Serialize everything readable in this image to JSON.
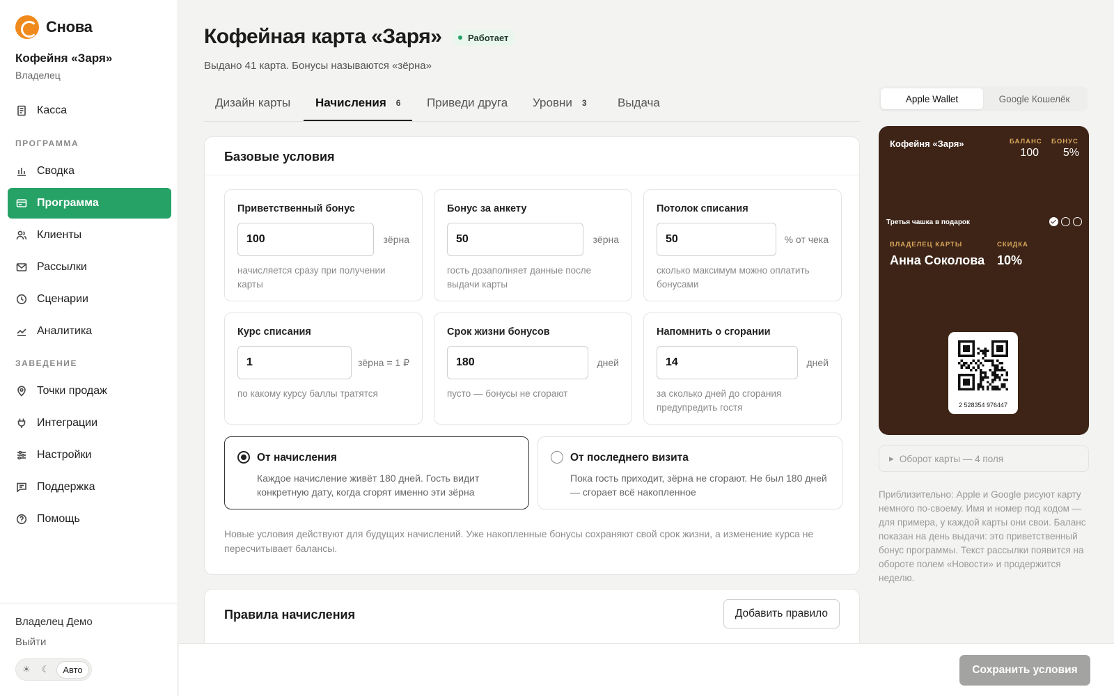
{
  "brand": {
    "name": "Снова",
    "accent": "#26a266",
    "logo_color": "#f08a1c"
  },
  "venue": {
    "name": "Кофейня «Заря»",
    "role": "Владелец"
  },
  "nav": {
    "top": [
      {
        "label": "Касса",
        "icon": "receipt-icon"
      }
    ],
    "program_section": "ПРОГРАММА",
    "program_items": [
      {
        "label": "Сводка",
        "icon": "bar-chart-icon"
      },
      {
        "label": "Программа",
        "icon": "card-icon",
        "active": true
      },
      {
        "label": "Клиенты",
        "icon": "users-icon"
      },
      {
        "label": "Рассылки",
        "icon": "mail-icon"
      },
      {
        "label": "Сценарии",
        "icon": "clock-icon"
      },
      {
        "label": "Аналитика",
        "icon": "trend-icon"
      }
    ],
    "venue_section": "ЗАВЕДЕНИЕ",
    "venue_items": [
      {
        "label": "Точки продаж",
        "icon": "pin-icon"
      },
      {
        "label": "Интеграции",
        "icon": "plug-icon"
      },
      {
        "label": "Настройки",
        "icon": "sliders-icon"
      },
      {
        "label": "Поддержка",
        "icon": "chat-icon"
      },
      {
        "label": "Помощь",
        "icon": "help-icon"
      }
    ]
  },
  "footer": {
    "user": "Владелец Демо",
    "logout": "Выйти",
    "theme_options": [
      "☀",
      "☾",
      "Авто"
    ],
    "theme_selected": "Авто"
  },
  "page": {
    "title": "Кофейная карта «Заря»",
    "status": "Работает",
    "subtitle": "Выдано 41 карта. Бонусы называются «зёрна»"
  },
  "tabs": [
    {
      "label": "Дизайн карты",
      "count": ""
    },
    {
      "label": "Начисления",
      "count": "6",
      "active": true
    },
    {
      "label": "Приведи друга",
      "count": ""
    },
    {
      "label": "Уровни",
      "count": "3"
    },
    {
      "label": "Выдача",
      "count": ""
    }
  ],
  "base": {
    "title": "Базовые условия",
    "fields": [
      {
        "label": "Приветственный бонус",
        "value": "100",
        "unit": "зёрна",
        "hint": "начисляется сразу при получении карты"
      },
      {
        "label": "Бонус за анкету",
        "value": "50",
        "unit": "зёрна",
        "hint": "гость дозаполняет данные после выдачи карты"
      },
      {
        "label": "Потолок списания",
        "value": "50",
        "unit": "% от чека",
        "hint": "сколько максимум можно оплатить бонусами"
      },
      {
        "label": "Курс списания",
        "value": "1",
        "unit": "зёрна = 1 ₽",
        "hint": "по какому курсу баллы тратятся"
      },
      {
        "label": "Срок жизни бонусов",
        "value": "180",
        "unit": "дней",
        "hint": "пусто — бонусы не сгорают"
      },
      {
        "label": "Напомнить о сгорании",
        "value": "14",
        "unit": "дней",
        "hint": "за сколько дней до сгорания предупредить гостя"
      }
    ],
    "expiry_options": [
      {
        "title": "От начисления",
        "desc": "Каждое начисление живёт 180 дней. Гость видит конкретную дату, когда сгорят именно эти зёрна",
        "checked": true
      },
      {
        "title": "От последнего визита",
        "desc": "Пока гость приходит, зёрна не сгорают. Не был 180 дней — сгорает всё накопленное",
        "checked": false
      }
    ],
    "note": "Новые условия действуют для будущих начислений. Уже накопленные бонусы сохраняют свой срок жизни, а изменение курса не пересчитывает балансы."
  },
  "rules": {
    "title": "Правила начисления",
    "add_button": "Добавить правило"
  },
  "save_button": "Сохранить условия",
  "wallet": {
    "tabs": [
      "Apple Wallet",
      "Google Кошелёк"
    ],
    "active_tab": "Apple Wallet",
    "card": {
      "venue": "Кофейня «Заря»",
      "balance_label": "БАЛАНС",
      "balance": "100",
      "bonus_label": "БОНУС",
      "bonus": "5%",
      "promo": "Третья чашка в подарок",
      "stamps_filled": 1,
      "stamps_total": 3,
      "holder_label": "ВЛАДЕЛЕЦ КАРТЫ",
      "holder": "Анна Соколова",
      "discount_label": "СКИДКА",
      "discount": "10%",
      "code": "2 528354 976447",
      "bg_color": "#3d2417",
      "label_color": "#d9a65c"
    },
    "flip": "Оборот карты — 4 поля",
    "note": "Приблизительно: Apple и Google рисуют карту немного по-своему. Имя и номер под кодом — для примера, у каждой карты они свои. Баланс показан на день выдачи: это приветственный бонус программы. Текст рассылки появится на обороте полем «Новости» и продержится неделю."
  }
}
